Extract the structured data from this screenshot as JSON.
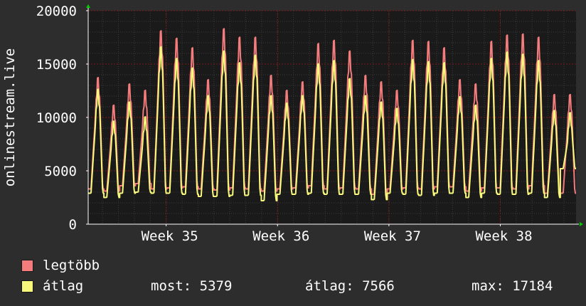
{
  "chart_data": {
    "type": "line",
    "ylabel": "onlinestream.live",
    "ylim": [
      0,
      20000
    ],
    "yticks": [
      0,
      5000,
      10000,
      15000,
      20000
    ],
    "ytick_labels": [
      "0",
      "5000",
      "10000",
      "15000",
      "20000"
    ],
    "x_start_week": 34.3,
    "x_end_week": 38.68,
    "xtick_labels": [
      "Week 35",
      "Week 36",
      "Week 37",
      "Week 38"
    ],
    "xtick_positions_week": [
      35,
      36,
      37,
      38
    ],
    "grid": true,
    "series": [
      {
        "name": "legtöbb",
        "color": "#f47c7c",
        "daily_peaks": [
          13800,
          11200,
          13200,
          12600,
          18200,
          17500,
          16600,
          13600,
          18400,
          17600,
          17600,
          14000,
          12600,
          13400,
          17000,
          17300,
          16300,
          14000,
          13400,
          12600,
          17300,
          17200,
          16600,
          13600,
          13200,
          17200,
          17800,
          17900,
          17600,
          12200,
          12200
        ],
        "daily_troughs": [
          3300,
          3100,
          3600,
          3800,
          3300,
          3400,
          3500,
          3300,
          3200,
          3400,
          3300,
          3100,
          3300,
          3400,
          3600,
          3300,
          3400,
          3300,
          2800,
          3300,
          3400,
          3300,
          3500,
          3500,
          3100,
          3400,
          3400,
          3300,
          3600,
          2900,
          2900
        ]
      },
      {
        "name": "átlag",
        "color": "#f9f97c",
        "daily_peaks": [
          12700,
          9700,
          11500,
          10100,
          16700,
          15600,
          14700,
          12100,
          16300,
          15200,
          15900,
          12100,
          11400,
          12100,
          15100,
          15400,
          13700,
          12100,
          11500,
          10900,
          15500,
          15300,
          15200,
          12000,
          11200,
          15600,
          16200,
          16000,
          15400,
          10700,
          10500
        ],
        "daily_troughs": [
          2900,
          2500,
          2900,
          3000,
          2900,
          2900,
          2800,
          2600,
          2600,
          2700,
          2700,
          2200,
          2800,
          2800,
          2900,
          2800,
          2800,
          2800,
          2300,
          2900,
          2800,
          2700,
          2900,
          2900,
          2500,
          2900,
          2800,
          2800,
          2900,
          2500,
          5200
        ]
      }
    ]
  },
  "legend": {
    "items": [
      {
        "label": "legtöbb",
        "color": "#f47c7c"
      },
      {
        "label": "átlag",
        "color": "#f9f97c"
      }
    ],
    "stats": {
      "most": "most: 5379",
      "atlag": "átlag: 7566",
      "max": "max: 17184"
    }
  },
  "colors": {
    "background": "#2d2d2d",
    "plot_background": "#1a1a1a",
    "major_grid": "#7a1a1a",
    "minor_grid": "#3a3a3a",
    "axis_arrow": "#00cc00"
  }
}
